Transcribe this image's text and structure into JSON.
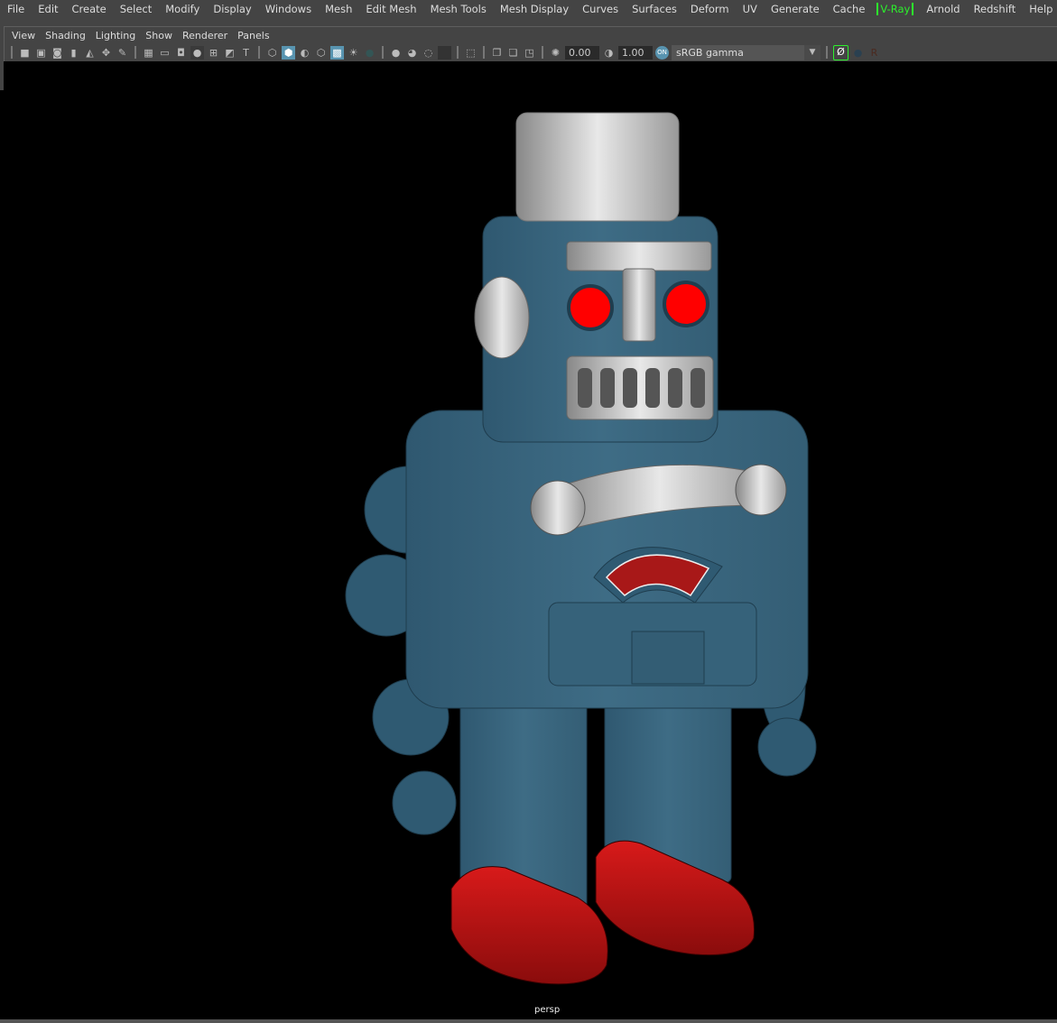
{
  "menubar": {
    "items": [
      "File",
      "Edit",
      "Create",
      "Select",
      "Modify",
      "Display",
      "Windows",
      "Mesh",
      "Edit Mesh",
      "Mesh Tools",
      "Mesh Display",
      "Curves",
      "Surfaces",
      "Deform",
      "UV",
      "Generate",
      "Cache",
      "V-Ray",
      "Arnold",
      "Redshift",
      "Help"
    ]
  },
  "panel_menu": {
    "items": [
      "View",
      "Shading",
      "Lighting",
      "Show",
      "Renderer",
      "Panels"
    ]
  },
  "toolbar": {
    "exposure": "0.00",
    "gamma": "1.00",
    "color_management_toggle": "ON",
    "view_transform": "sRGB gamma",
    "icons": [
      "camera-select-icon",
      "lock-camera-icon",
      "camera-attributes-icon",
      "bookmark-icon",
      "image-plane-icon",
      "2d-pan-zoom-icon",
      "grease-pencil-icon",
      "grid-icon",
      "film-gate-icon",
      "resolution-gate-icon",
      "gate-mask-icon",
      "field-chart-icon",
      "safe-action-icon",
      "safe-title-icon",
      "wireframe-icon",
      "smooth-shade-icon",
      "wireframe-on-shaded-icon",
      "default-material-icon",
      "textured-icon",
      "lights-icon",
      "shadows-icon",
      "screen-space-ao-icon",
      "motion-blur-icon",
      "anti-aliasing-icon",
      "depth-of-field-icon",
      "isolate-select-icon",
      "xray-icon",
      "xray-joints-icon",
      "xray-components-icon",
      "exposure-icon",
      "gamma-icon"
    ]
  },
  "viewport": {
    "camera_label": "persp"
  },
  "colors": {
    "robot_body": "#3c6a82",
    "robot_feet": "#c41414",
    "eyes": "#ff0000",
    "chrome": "#b8b8b8",
    "vray_accent": "#2cf02c",
    "toggle_on": "#5894b0"
  }
}
